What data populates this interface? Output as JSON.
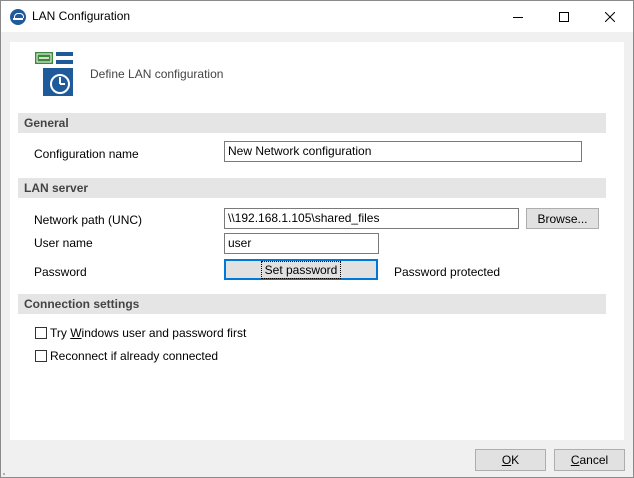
{
  "window": {
    "title": "LAN Configuration",
    "icon": "app-icon",
    "minimize_icon": "minimize-icon",
    "maximize_icon": "maximize-icon",
    "close_icon": "close-icon"
  },
  "header": {
    "icon": "lan-config-icon",
    "subtitle": "Define LAN configuration"
  },
  "general": {
    "heading": "General",
    "config_name_label": "Configuration name",
    "config_name_value": "New Network configuration"
  },
  "lan_server": {
    "heading": "LAN server",
    "network_path_label": "Network path (UNC)",
    "network_path_value": "\\\\192.168.1.105\\shared_files",
    "browse_label": "Browse...",
    "user_name_label": "User name",
    "user_name_value": "user",
    "password_label": "Password",
    "set_password_label": "Set password",
    "password_status": "Password protected"
  },
  "connection": {
    "heading": "Connection settings",
    "try_windows_prefix": "Try ",
    "try_windows_accel": "W",
    "try_windows_suffix": "indows user and password first",
    "try_windows_checked": false,
    "reconnect_label": "Reconnect if already connected",
    "reconnect_checked": false
  },
  "footer": {
    "ok_accel": "O",
    "ok_rest": "K",
    "cancel_accel": "C",
    "cancel_rest": "ancel"
  }
}
